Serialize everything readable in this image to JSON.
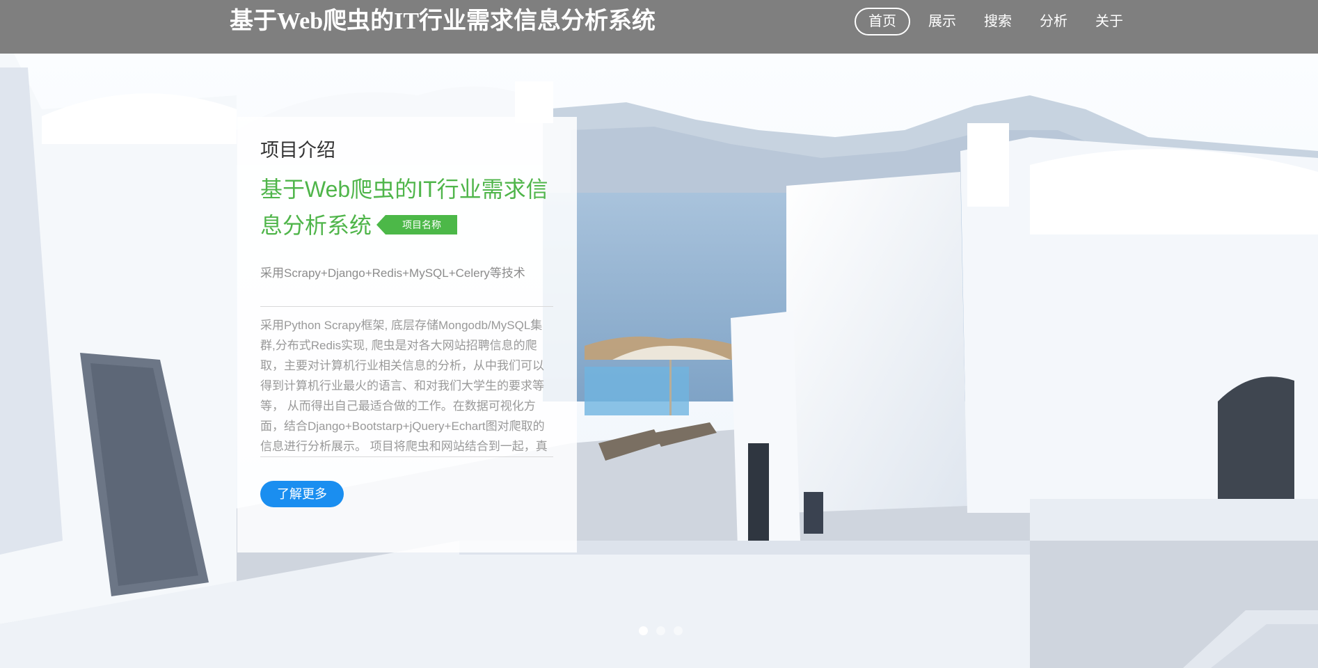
{
  "header": {
    "site_title": "基于Web爬虫的IT行业需求信息分析系统",
    "nav": [
      {
        "label": "首页",
        "active": true
      },
      {
        "label": "展示",
        "active": false
      },
      {
        "label": "搜索",
        "active": false
      },
      {
        "label": "分析",
        "active": false
      },
      {
        "label": "关于",
        "active": false
      }
    ]
  },
  "card": {
    "kicker": "项目介绍",
    "title": "基于Web爬虫的IT行业需求信息分析系统",
    "tag": "项目名称",
    "subtitle": "采用Scrapy+Django+Redis+MySQL+Celery等技术",
    "body": "采用Python Scrapy框架, 底层存储Mongodb/MySQL集群,分布式Redis实现, 爬虫是对各大网站招聘信息的爬取，主要对计算机行业相关信息的分析，从中我们可以得到计算机行业最火的语言、和对我们大学生的要求等等，  从而得出自己最适合做的工作。在数据可视化方面，结合Django+Bootstarp+jQuery+Echart图对爬取的信息进行分析展示。 项目将爬虫和网站结合到一起，真正实现职位信息收集和分析的网站系统。",
    "button": "了解更多"
  },
  "carousel": {
    "slide_count": 3,
    "active_index": 0
  },
  "colors": {
    "topbar": "#7f7f7f",
    "title_green": "#4fb54a",
    "tag_green": "#4cb848",
    "button_blue": "#1a8ef0"
  }
}
